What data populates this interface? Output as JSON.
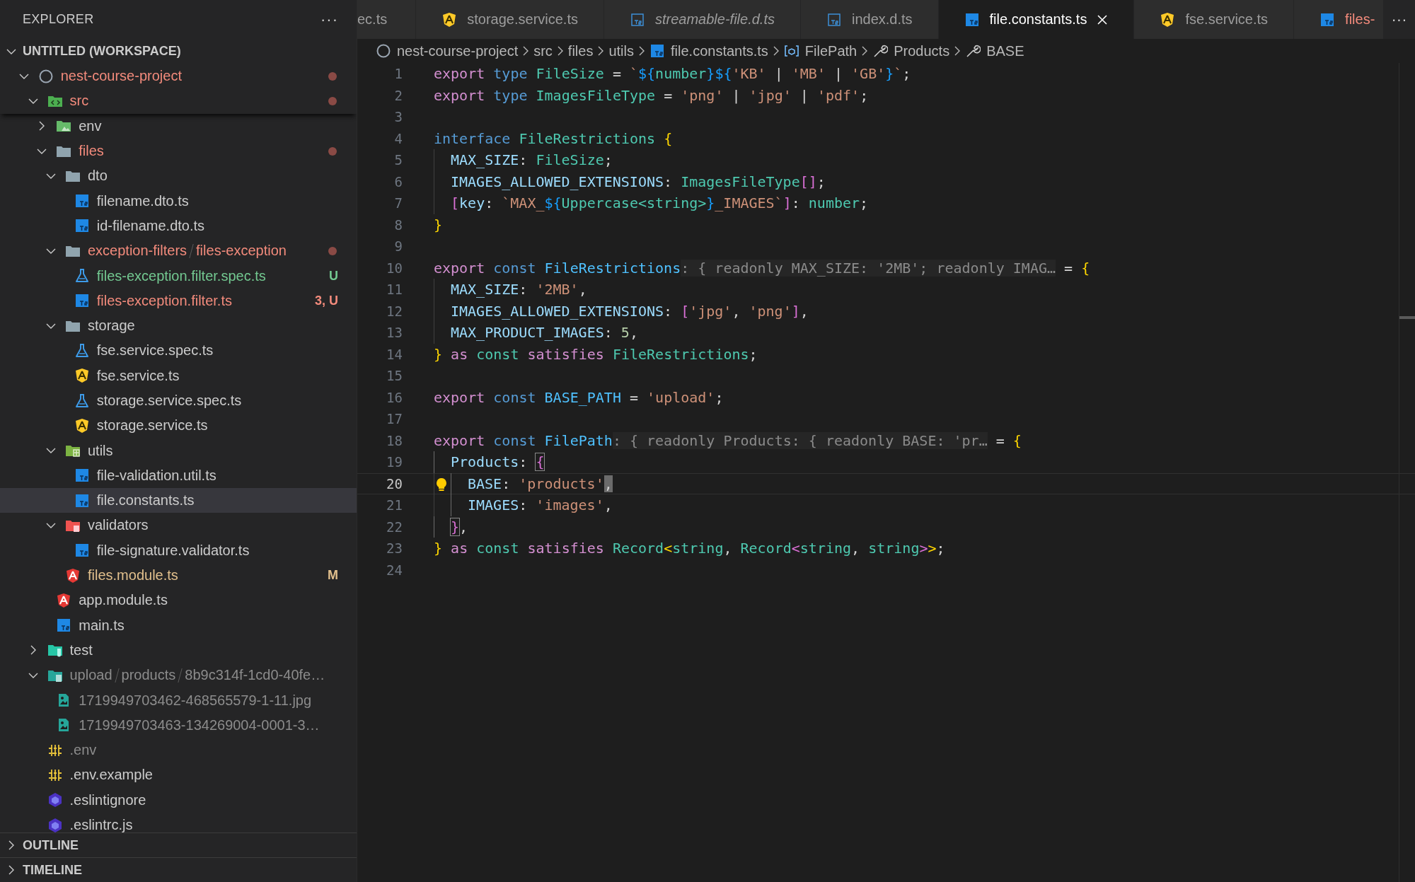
{
  "explorer": {
    "title": "EXPLORER",
    "more": "···"
  },
  "workspace": {
    "title": "UNTITLED (WORKSPACE)",
    "expanded": true,
    "tree": [
      {
        "name": "nest-course-project",
        "kind": "root",
        "expanded": true,
        "selected": false,
        "color": "#f38b7c",
        "dot": true,
        "children": [
          {
            "name": "src",
            "kind": "src",
            "expanded": true,
            "selected": false,
            "color": "#f38b7c",
            "dot": true,
            "children": [
              {
                "name": "env",
                "kind": "env",
                "expanded": false,
                "selected": false
              },
              {
                "name": "files",
                "kind": "folder",
                "expanded": true,
                "selected": false,
                "color": "#f38b7c",
                "dot": true,
                "children": [
                  {
                    "name": "dto",
                    "kind": "folder",
                    "expanded": true,
                    "selected": false,
                    "children": [
                      {
                        "name": "filename.dto.ts",
                        "kind": "ts",
                        "selected": false
                      },
                      {
                        "name": "id-filename.dto.ts",
                        "kind": "ts",
                        "selected": false
                      }
                    ]
                  },
                  {
                    "name_parts": [
                      "exception-filters",
                      "files-exception"
                    ],
                    "kind": "folder",
                    "expanded": true,
                    "selected": false,
                    "color": "#f38b7c",
                    "dot": true,
                    "children": [
                      {
                        "name": "files-exception.filter.spec.ts",
                        "kind": "spec",
                        "selected": false,
                        "color": "#73c991",
                        "badge": "U"
                      },
                      {
                        "name": "files-exception.filter.ts",
                        "kind": "ts",
                        "selected": false,
                        "color": "#f38b7c",
                        "badge": "3, U"
                      }
                    ]
                  },
                  {
                    "name": "storage",
                    "kind": "folder",
                    "expanded": true,
                    "selected": false,
                    "children": [
                      {
                        "name": "fse.service.spec.ts",
                        "kind": "spec",
                        "selected": false
                      },
                      {
                        "name": "fse.service.ts",
                        "kind": "service",
                        "selected": false
                      },
                      {
                        "name": "storage.service.spec.ts",
                        "kind": "spec",
                        "selected": false
                      },
                      {
                        "name": "storage.service.ts",
                        "kind": "service",
                        "selected": false
                      }
                    ]
                  },
                  {
                    "name": "utils",
                    "kind": "utils",
                    "expanded": true,
                    "selected": false,
                    "children": [
                      {
                        "name": "file-validation.util.ts",
                        "kind": "ts",
                        "selected": false
                      },
                      {
                        "name": "file.constants.ts",
                        "kind": "ts",
                        "selected": true
                      }
                    ]
                  },
                  {
                    "name": "validators",
                    "kind": "validators",
                    "expanded": true,
                    "selected": false,
                    "children": [
                      {
                        "name": "file-signature.validator.ts",
                        "kind": "ts",
                        "selected": false
                      }
                    ]
                  },
                  {
                    "name": "files.module.ts",
                    "kind": "module",
                    "selected": false,
                    "color": "#e2c08d",
                    "badge": "M"
                  }
                ]
              },
              {
                "name": "app.module.ts",
                "kind": "module",
                "selected": false
              },
              {
                "name": "main.ts",
                "kind": "ts",
                "selected": false
              }
            ]
          },
          {
            "name": "test",
            "kind": "test",
            "expanded": false,
            "selected": false
          },
          {
            "name_parts": [
              "upload",
              "products",
              "8b9c314f-1cd0-40fe…"
            ],
            "kind": "upload",
            "expanded": true,
            "selected": false,
            "color": "#8c8c8c",
            "children": [
              {
                "name": "1719949703462-468565579-1-11.jpg",
                "kind": "image",
                "selected": false,
                "color": "#8c8c8c"
              },
              {
                "name": "1719949703463-134269004-0001-3…",
                "kind": "image",
                "selected": false,
                "color": "#8c8c8c"
              }
            ]
          },
          {
            "name": ".env",
            "kind": "dotenv",
            "selected": false,
            "color": "#8c8c8c"
          },
          {
            "name": ".env.example",
            "kind": "dotenv",
            "selected": false
          },
          {
            "name": ".eslintignore",
            "kind": "eslint",
            "selected": false
          },
          {
            "name": ".eslintrc.js",
            "kind": "eslint",
            "selected": false
          }
        ]
      }
    ]
  },
  "panels": [
    {
      "title": "OUTLINE",
      "expanded": false
    },
    {
      "title": "TIMELINE",
      "expanded": false
    }
  ],
  "tabs": [
    {
      "label": "ec.ts",
      "kind": "plain",
      "italic": false,
      "selected": false
    },
    {
      "label": "storage.service.ts",
      "kind": "service",
      "italic": false,
      "selected": false
    },
    {
      "label": "streamable-file.d.ts",
      "kind": "declaration",
      "italic": true,
      "selected": false
    },
    {
      "label": "index.d.ts",
      "kind": "declaration",
      "italic": false,
      "selected": false
    },
    {
      "label": "file.constants.ts",
      "kind": "ts",
      "italic": false,
      "selected": true
    },
    {
      "label": "fse.service.ts",
      "kind": "service",
      "italic": false,
      "selected": false
    },
    {
      "label": "files-",
      "kind": "ts",
      "italic": false,
      "selected": false,
      "color": "#f38b7c"
    }
  ],
  "tab_actions": "···",
  "breadcrumb": [
    {
      "label": "nest-course-project",
      "kind": "root"
    },
    {
      "label": "src",
      "kind": "plain"
    },
    {
      "label": "files",
      "kind": "plain"
    },
    {
      "label": "utils",
      "kind": "plain"
    },
    {
      "label": "file.constants.ts",
      "kind": "ts"
    },
    {
      "label": "FilePath",
      "kind": "variable"
    },
    {
      "label": "Products",
      "kind": "property"
    },
    {
      "label": "BASE",
      "kind": "property"
    }
  ],
  "code": [
    {
      "number": "1",
      "current": false,
      "lightbulb": false,
      "tokens": [
        {
          "kind": "kw",
          "text": "export "
        },
        {
          "kind": "st",
          "text": "type "
        },
        {
          "kind": "ty",
          "text": "FileSize"
        },
        {
          "kind": "p",
          "text": " = "
        },
        {
          "kind": "str",
          "text": "`"
        },
        {
          "kind": "b3",
          "text": "${"
        },
        {
          "kind": "ty",
          "text": "number"
        },
        {
          "kind": "b3",
          "text": "}${"
        },
        {
          "kind": "str",
          "text": "'KB'"
        },
        {
          "kind": "p",
          "text": " | "
        },
        {
          "kind": "str",
          "text": "'MB'"
        },
        {
          "kind": "p",
          "text": " | "
        },
        {
          "kind": "str",
          "text": "'GB'"
        },
        {
          "kind": "b3",
          "text": "}"
        },
        {
          "kind": "str",
          "text": "`"
        },
        {
          "kind": "p",
          "text": ";"
        }
      ]
    },
    {
      "number": "2",
      "current": false,
      "lightbulb": false,
      "tokens": [
        {
          "kind": "kw",
          "text": "export "
        },
        {
          "kind": "st",
          "text": "type "
        },
        {
          "kind": "ty",
          "text": "ImagesFileType"
        },
        {
          "kind": "p",
          "text": " = "
        },
        {
          "kind": "str",
          "text": "'png'"
        },
        {
          "kind": "p",
          "text": " | "
        },
        {
          "kind": "str",
          "text": "'jpg'"
        },
        {
          "kind": "p",
          "text": " | "
        },
        {
          "kind": "str",
          "text": "'pdf'"
        },
        {
          "kind": "p",
          "text": ";"
        }
      ]
    },
    {
      "number": "3",
      "current": false,
      "lightbulb": false
    },
    {
      "number": "4",
      "current": false,
      "lightbulb": false,
      "tokens": [
        {
          "kind": "st",
          "text": "interface "
        },
        {
          "kind": "ty",
          "text": "FileRestrictions "
        },
        {
          "kind": "b1",
          "text": "{"
        }
      ]
    },
    {
      "number": "5",
      "current": false,
      "lightbulb": false,
      "tokens": [
        {
          "kind": "prop",
          "text": "  MAX_SIZE"
        },
        {
          "kind": "p",
          "text": ": "
        },
        {
          "kind": "ty",
          "text": "FileSize"
        },
        {
          "kind": "p",
          "text": ";"
        }
      ]
    },
    {
      "number": "6",
      "current": false,
      "lightbulb": false,
      "tokens": [
        {
          "kind": "prop",
          "text": "  IMAGES_ALLOWED_EXTENSIONS"
        },
        {
          "kind": "p",
          "text": ": "
        },
        {
          "kind": "ty",
          "text": "ImagesFileType"
        },
        {
          "kind": "b2",
          "text": "[]"
        },
        {
          "kind": "p",
          "text": ";"
        }
      ]
    },
    {
      "number": "7",
      "current": false,
      "lightbulb": false,
      "tokens": [
        {
          "kind": "b2",
          "text": "  ["
        },
        {
          "kind": "prop",
          "text": "key"
        },
        {
          "kind": "p",
          "text": ": "
        },
        {
          "kind": "str",
          "text": "`MAX_"
        },
        {
          "kind": "b3",
          "text": "${"
        },
        {
          "kind": "ty",
          "text": "Uppercase<string>"
        },
        {
          "kind": "b3",
          "text": "}"
        },
        {
          "kind": "str",
          "text": "_IMAGES`"
        },
        {
          "kind": "b2",
          "text": "]"
        },
        {
          "kind": "p",
          "text": ": "
        },
        {
          "kind": "ty",
          "text": "number"
        },
        {
          "kind": "p",
          "text": ";"
        }
      ]
    },
    {
      "number": "8",
      "current": false,
      "lightbulb": false,
      "tokens": [
        {
          "kind": "b1",
          "text": "}"
        }
      ]
    },
    {
      "number": "9",
      "current": false,
      "lightbulb": false
    },
    {
      "number": "10",
      "current": false,
      "lightbulb": false,
      "tokens": [
        {
          "kind": "kw",
          "text": "export "
        },
        {
          "kind": "st",
          "text": "const "
        },
        {
          "kind": "cn",
          "text": "FileRestrictions"
        },
        {
          "kind": "hint",
          "text": ": { readonly MAX_SIZE: '2MB'; readonly IMAG…"
        },
        {
          "kind": "p",
          "text": " = "
        },
        {
          "kind": "b1",
          "text": "{"
        }
      ]
    },
    {
      "number": "11",
      "current": false,
      "lightbulb": false,
      "tokens": [
        {
          "kind": "prop",
          "text": "  MAX_SIZE"
        },
        {
          "kind": "p",
          "text": ": "
        },
        {
          "kind": "str",
          "text": "'2MB'"
        },
        {
          "kind": "p",
          "text": ","
        }
      ]
    },
    {
      "number": "12",
      "current": false,
      "lightbulb": false,
      "tokens": [
        {
          "kind": "prop",
          "text": "  IMAGES_ALLOWED_EXTENSIONS"
        },
        {
          "kind": "p",
          "text": ": "
        },
        {
          "kind": "b2",
          "text": "["
        },
        {
          "kind": "str",
          "text": "'jpg'"
        },
        {
          "kind": "p",
          "text": ", "
        },
        {
          "kind": "str",
          "text": "'png'"
        },
        {
          "kind": "b2",
          "text": "]"
        },
        {
          "kind": "p",
          "text": ","
        }
      ]
    },
    {
      "number": "13",
      "current": false,
      "lightbulb": false,
      "tokens": [
        {
          "kind": "prop",
          "text": "  MAX_PRODUCT_IMAGES"
        },
        {
          "kind": "p",
          "text": ": "
        },
        {
          "kind": "num",
          "text": "5"
        },
        {
          "kind": "p",
          "text": ","
        }
      ]
    },
    {
      "number": "14",
      "current": false,
      "lightbulb": false,
      "tokens": [
        {
          "kind": "b1",
          "text": "}"
        },
        {
          "kind": "kw",
          "text": " as "
        },
        {
          "kind": "ty",
          "text": "const "
        },
        {
          "kind": "kw",
          "text": "satisfies "
        },
        {
          "kind": "ty",
          "text": "FileRestrictions"
        },
        {
          "kind": "p",
          "text": ";"
        }
      ]
    },
    {
      "number": "15",
      "current": false,
      "lightbulb": false
    },
    {
      "number": "16",
      "current": false,
      "lightbulb": false,
      "tokens": [
        {
          "kind": "kw",
          "text": "export "
        },
        {
          "kind": "st",
          "text": "const "
        },
        {
          "kind": "cn",
          "text": "BASE_PATH"
        },
        {
          "kind": "p",
          "text": " = "
        },
        {
          "kind": "str",
          "text": "'upload'"
        },
        {
          "kind": "p",
          "text": ";"
        }
      ]
    },
    {
      "number": "17",
      "current": false,
      "lightbulb": false
    },
    {
      "number": "18",
      "current": false,
      "lightbulb": false,
      "tokens": [
        {
          "kind": "kw",
          "text": "export "
        },
        {
          "kind": "st",
          "text": "const "
        },
        {
          "kind": "cn",
          "text": "FilePath"
        },
        {
          "kind": "hint",
          "text": ": { readonly Products: { readonly BASE: 'pr…"
        },
        {
          "kind": "p",
          "text": " = "
        },
        {
          "kind": "b1",
          "text": "{"
        }
      ]
    },
    {
      "number": "19",
      "current": false,
      "lightbulb": false,
      "tokens": [
        {
          "kind": "prop",
          "text": "  Products"
        },
        {
          "kind": "p",
          "text": ": "
        },
        {
          "kind": "b2",
          "text": "{",
          "matched": true
        }
      ]
    },
    {
      "number": "20",
      "current": true,
      "lightbulb": true,
      "tokens": [
        {
          "kind": "prop",
          "text": "    BASE"
        },
        {
          "kind": "p",
          "text": ": "
        },
        {
          "kind": "str",
          "text": "'products'"
        },
        {
          "kind": "p",
          "text": ",",
          "cursor": true
        }
      ]
    },
    {
      "number": "21",
      "current": false,
      "lightbulb": false,
      "tokens": [
        {
          "kind": "prop",
          "text": "    IMAGES"
        },
        {
          "kind": "p",
          "text": ": "
        },
        {
          "kind": "str",
          "text": "'images'"
        },
        {
          "kind": "p",
          "text": ","
        }
      ]
    },
    {
      "number": "22",
      "current": false,
      "lightbulb": false,
      "tokens": [
        {
          "kind": "b2",
          "text": "  }",
          "matched": true
        },
        {
          "kind": "p",
          "text": ","
        }
      ]
    },
    {
      "number": "23",
      "current": false,
      "lightbulb": false,
      "tokens": [
        {
          "kind": "b1",
          "text": "}"
        },
        {
          "kind": "kw",
          "text": " as "
        },
        {
          "kind": "ty",
          "text": "const "
        },
        {
          "kind": "kw",
          "text": "satisfies "
        },
        {
          "kind": "ty",
          "text": "Record"
        },
        {
          "kind": "b1",
          "text": "<"
        },
        {
          "kind": "ty",
          "text": "string"
        },
        {
          "kind": "p",
          "text": ", "
        },
        {
          "kind": "ty",
          "text": "Record"
        },
        {
          "kind": "b2",
          "text": "<"
        },
        {
          "kind": "ty",
          "text": "string"
        },
        {
          "kind": "p",
          "text": ", "
        },
        {
          "kind": "ty",
          "text": "string"
        },
        {
          "kind": "b2",
          "text": ">"
        },
        {
          "kind": "b1",
          "text": ">"
        },
        {
          "kind": "p",
          "text": ";"
        }
      ]
    },
    {
      "number": "24",
      "current": false,
      "lightbulb": false
    }
  ]
}
